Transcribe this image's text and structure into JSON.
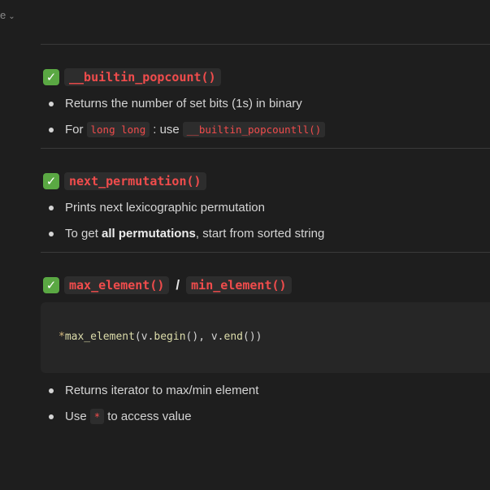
{
  "top": {
    "label": "e",
    "chevron": "⌄"
  },
  "sections": [
    {
      "heading": "__builtin_popcount()",
      "bullets": [
        {
          "text": "Returns the number of set bits (1s) in binary"
        },
        {
          "pre": "For",
          "code1": "long long",
          "mid": ": use",
          "code2": "__builtin_popcountll()"
        }
      ]
    },
    {
      "heading": "next_permutation()",
      "bullets": [
        {
          "text": "Prints next lexicographic permutation"
        },
        {
          "pre": "To get",
          "bold": "all permutations",
          "post": ", start from sorted string"
        }
      ]
    },
    {
      "heading_a": "max_element()",
      "separator": "/",
      "heading_b": "min_element()",
      "code": {
        "star": "*",
        "fn": "max_element",
        "p1": "(v.",
        "fn2": "begin",
        "p2": "(), v.",
        "fn3": "end",
        "p3": "())"
      },
      "bullets": [
        {
          "text": "Returns iterator to max/min element"
        },
        {
          "pre": "Use",
          "code": "*",
          "post": "to access value"
        }
      ]
    }
  ],
  "colors": {
    "background": "#1e1e1e",
    "check": "#5aa843",
    "inline_code": "#f14c4c",
    "function": "#dcdcaa"
  }
}
